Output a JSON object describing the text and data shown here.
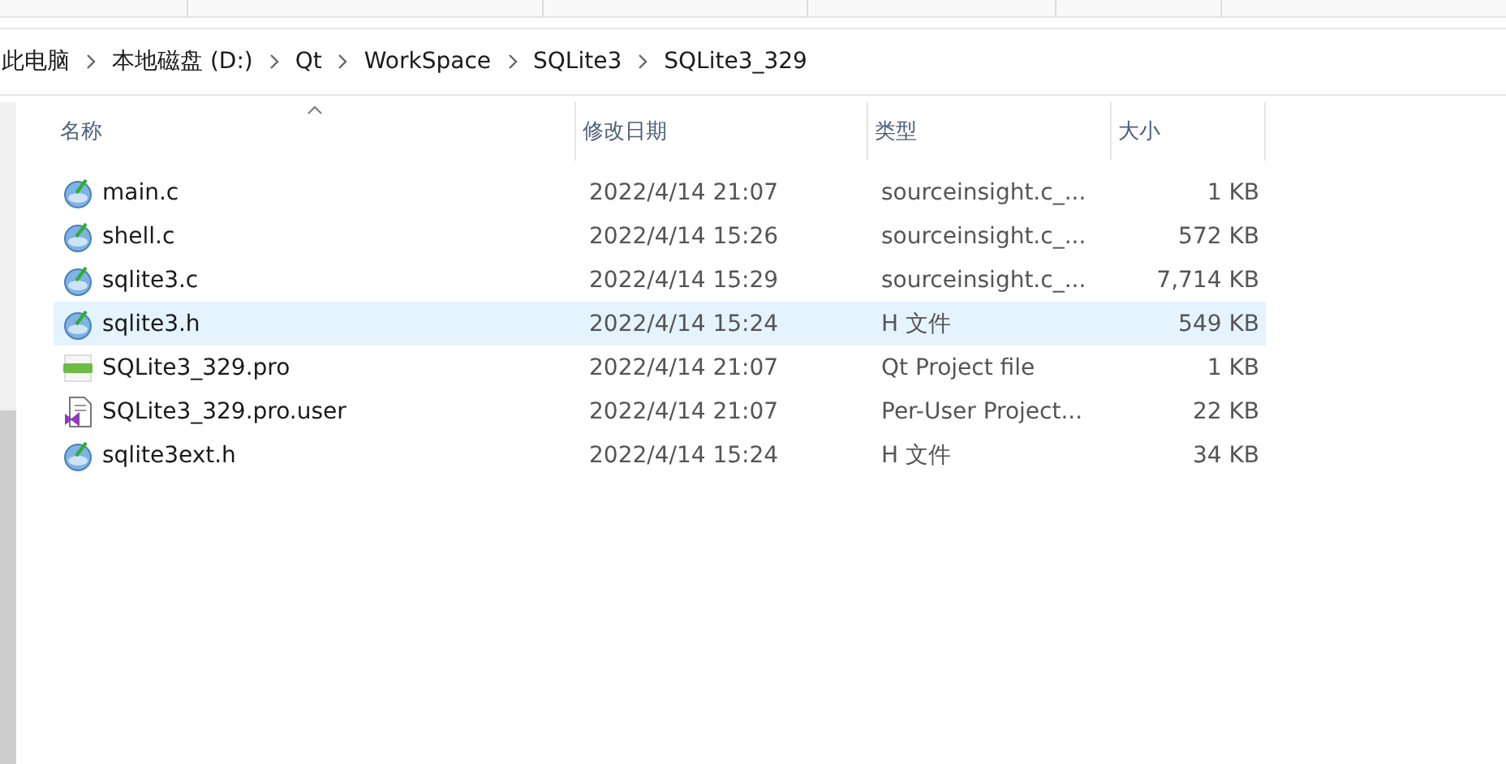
{
  "breadcrumb": [
    "此电脑",
    "本地磁盘 (D:)",
    "Qt",
    "WorkSpace",
    "SQLite3",
    "SQLite3_329"
  ],
  "columns": [
    {
      "label": "名称",
      "sorted": true
    },
    {
      "label": "修改日期",
      "sorted": false
    },
    {
      "label": "类型",
      "sorted": false
    },
    {
      "label": "大小",
      "sorted": false
    }
  ],
  "files": [
    {
      "name": "main.c",
      "kind": "source",
      "modified": "2022/4/14 21:07",
      "type": "sourceinsight.c_...",
      "size": "1 KB",
      "selected": false
    },
    {
      "name": "shell.c",
      "kind": "source",
      "modified": "2022/4/14 15:26",
      "type": "sourceinsight.c_...",
      "size": "572 KB",
      "selected": false
    },
    {
      "name": "sqlite3.c",
      "kind": "source",
      "modified": "2022/4/14 15:29",
      "type": "sourceinsight.c_...",
      "size": "7,714 KB",
      "selected": false
    },
    {
      "name": "sqlite3.h",
      "kind": "source",
      "modified": "2022/4/14 15:24",
      "type": "H 文件",
      "size": "549 KB",
      "selected": true
    },
    {
      "name": "SQLite3_329.pro",
      "kind": "qt-project",
      "modified": "2022/4/14 21:07",
      "type": "Qt Project file",
      "size": "1 KB",
      "selected": false
    },
    {
      "name": "SQLite3_329.pro.user",
      "kind": "vs-user",
      "modified": "2022/4/14 21:07",
      "type": "Per-User Project...",
      "size": "22 KB",
      "selected": false
    },
    {
      "name": "sqlite3ext.h",
      "kind": "source",
      "modified": "2022/4/14 15:24",
      "type": "H 文件",
      "size": "34 KB",
      "selected": false
    }
  ]
}
